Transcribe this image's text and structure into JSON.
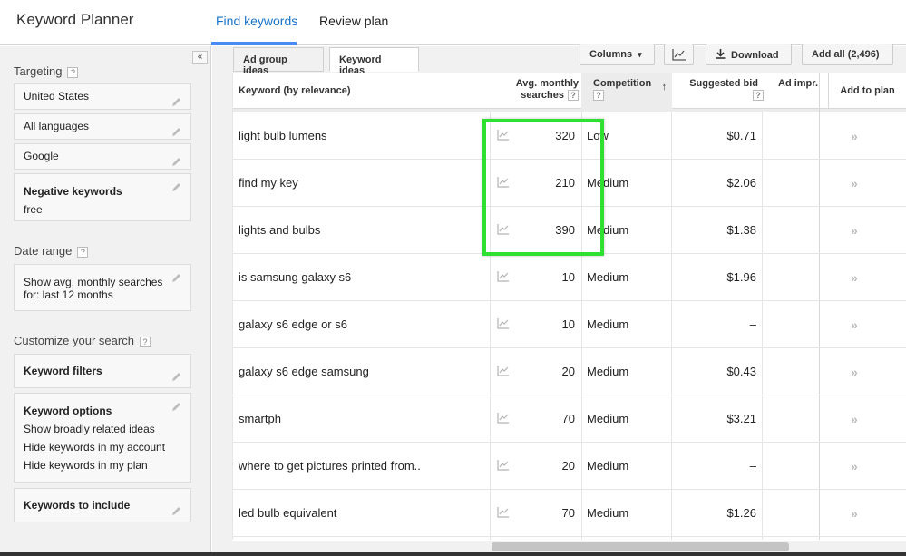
{
  "app": {
    "title": "Keyword Planner"
  },
  "nav": {
    "tabs": [
      {
        "label": "Find keywords"
      },
      {
        "label": "Review plan"
      }
    ]
  },
  "sidebar": {
    "collapse_label": "«",
    "targeting_label": "Targeting",
    "help": "?",
    "targeting_items": [
      "United States",
      "All languages",
      "Google"
    ],
    "negative": {
      "title": "Negative keywords",
      "value": "free"
    },
    "date_label": "Date range",
    "date_value": "Show avg. monthly searches for: last 12 months",
    "customize_label": "Customize your search",
    "keyword_filters": "Keyword filters",
    "keyword_options": {
      "title": "Keyword options",
      "lines": [
        "Show broadly related ideas",
        "Hide keywords in my account",
        "Hide keywords in my plan"
      ]
    },
    "keywords_include": "Keywords to include"
  },
  "subtabs": [
    "Ad group ideas",
    "Keyword ideas"
  ],
  "toolbar": {
    "columns": "Columns",
    "columns_caret": "▾",
    "download": "Download",
    "add_all": "Add all (2,496)"
  },
  "table": {
    "headers": {
      "keyword": "Keyword (by relevance)",
      "searches_1": "Avg. monthly",
      "searches_2": "searches",
      "competition": "Competition",
      "sort_arrow": "↑",
      "bid": "Suggested bid",
      "impr": "Ad impr.",
      "add": "Add to plan"
    },
    "plan_arrow": "»",
    "rows": [
      {
        "keyword": "light bulb lumens",
        "searches": "320",
        "competition": "Low",
        "bid": "$0.71"
      },
      {
        "keyword": "find my key",
        "searches": "210",
        "competition": "Medium",
        "bid": "$2.06"
      },
      {
        "keyword": "lights and bulbs",
        "searches": "390",
        "competition": "Medium",
        "bid": "$1.38"
      },
      {
        "keyword": "is samsung galaxy s6",
        "searches": "10",
        "competition": "Medium",
        "bid": "$1.96"
      },
      {
        "keyword": "galaxy s6 edge or s6",
        "searches": "10",
        "competition": "Medium",
        "bid": "–"
      },
      {
        "keyword": "galaxy s6 edge samsung",
        "searches": "20",
        "competition": "Medium",
        "bid": "$0.43"
      },
      {
        "keyword": "smartph",
        "searches": "70",
        "competition": "Medium",
        "bid": "$3.21"
      },
      {
        "keyword": "where to get pictures printed from..",
        "searches": "20",
        "competition": "Medium",
        "bid": "–"
      },
      {
        "keyword": "led bulb equivalent",
        "searches": "70",
        "competition": "Medium",
        "bid": "$1.26"
      }
    ]
  },
  "colors": {
    "highlight": "#2ee031",
    "accent": "#4a8af4"
  }
}
